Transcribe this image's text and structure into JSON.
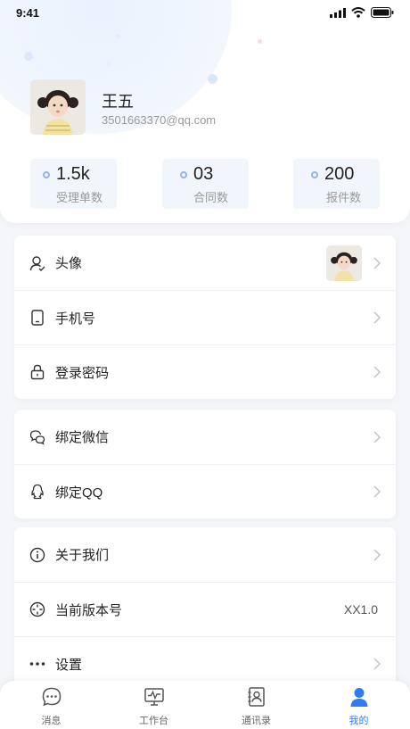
{
  "status_bar": {
    "time": "9:41"
  },
  "profile": {
    "name": "王五",
    "email": "3501663370@qq.com"
  },
  "stats": [
    {
      "value": "1.5k",
      "label": "受理单数"
    },
    {
      "value": "03",
      "label": "合同数"
    },
    {
      "value": "200",
      "label": "报件数"
    }
  ],
  "account_group": {
    "avatar_label": "头像",
    "phone_label": "手机号",
    "password_label": "登录密码"
  },
  "binding_group": {
    "wechat_label": "绑定微信",
    "qq_label": "绑定QQ"
  },
  "about_group": {
    "about_label": "关于我们",
    "version_label": "当前版本号",
    "version_value": "XX1.0",
    "settings_label": "设置"
  },
  "tabbar": {
    "tabs": [
      {
        "label": "消息",
        "icon": "message-icon"
      },
      {
        "label": "工作台",
        "icon": "workbench-icon"
      },
      {
        "label": "通讯录",
        "icon": "contacts-icon"
      },
      {
        "label": "我的",
        "icon": "profile-icon"
      }
    ],
    "active_index": 3
  },
  "colors": {
    "accent": "#2f7bf5",
    "stat_bg": "#f1f6fd",
    "page_bg": "#f4f6f9"
  }
}
